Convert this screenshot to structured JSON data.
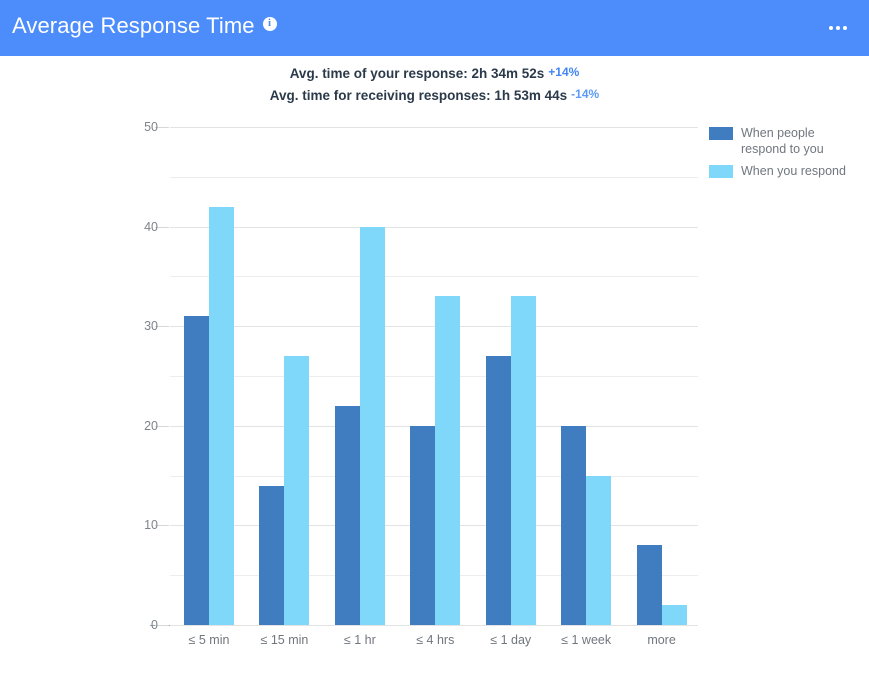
{
  "header": {
    "title": "Average Response Time",
    "info_icon": "info-icon",
    "menu_icon": "more-options-icon"
  },
  "summary": {
    "line1_text": "Avg. time of your response: 2h 34m 52s",
    "line1_delta": "+14%",
    "line2_text": "Avg. time for receiving responses: 1h 53m 44s",
    "line2_delta": "-14%"
  },
  "colors": {
    "header_bg": "#4d8dfb",
    "series_dark": "#3f7cc0",
    "series_light": "#7fd8fa",
    "delta_positive": "#4285f4",
    "delta_negative": "#5b9bf5"
  },
  "chart_data": {
    "type": "bar",
    "title": "Average Response Time",
    "xlabel": "",
    "ylabel": "",
    "ylim": [
      0,
      50
    ],
    "yticks": [
      0,
      10,
      20,
      30,
      40,
      50
    ],
    "minor_yticks": [
      5,
      15,
      25,
      35,
      45
    ],
    "grid": true,
    "legend_position": "right",
    "categories": [
      "≤ 5 min",
      "≤ 15 min",
      "≤ 1 hr",
      "≤ 4 hrs",
      "≤ 1 day",
      "≤ 1 week",
      "more"
    ],
    "series": [
      {
        "name": "When people respond to you",
        "color": "#3f7cc0",
        "values": [
          31,
          14,
          22,
          20,
          27,
          20,
          8
        ]
      },
      {
        "name": "When you respond",
        "color": "#7fd8fa",
        "values": [
          42,
          27,
          40,
          33,
          33,
          15,
          2
        ]
      }
    ]
  },
  "legend": {
    "items": [
      {
        "label": "When people respond to you",
        "swatch": "s0"
      },
      {
        "label": "When you respond",
        "swatch": "s1"
      }
    ]
  }
}
